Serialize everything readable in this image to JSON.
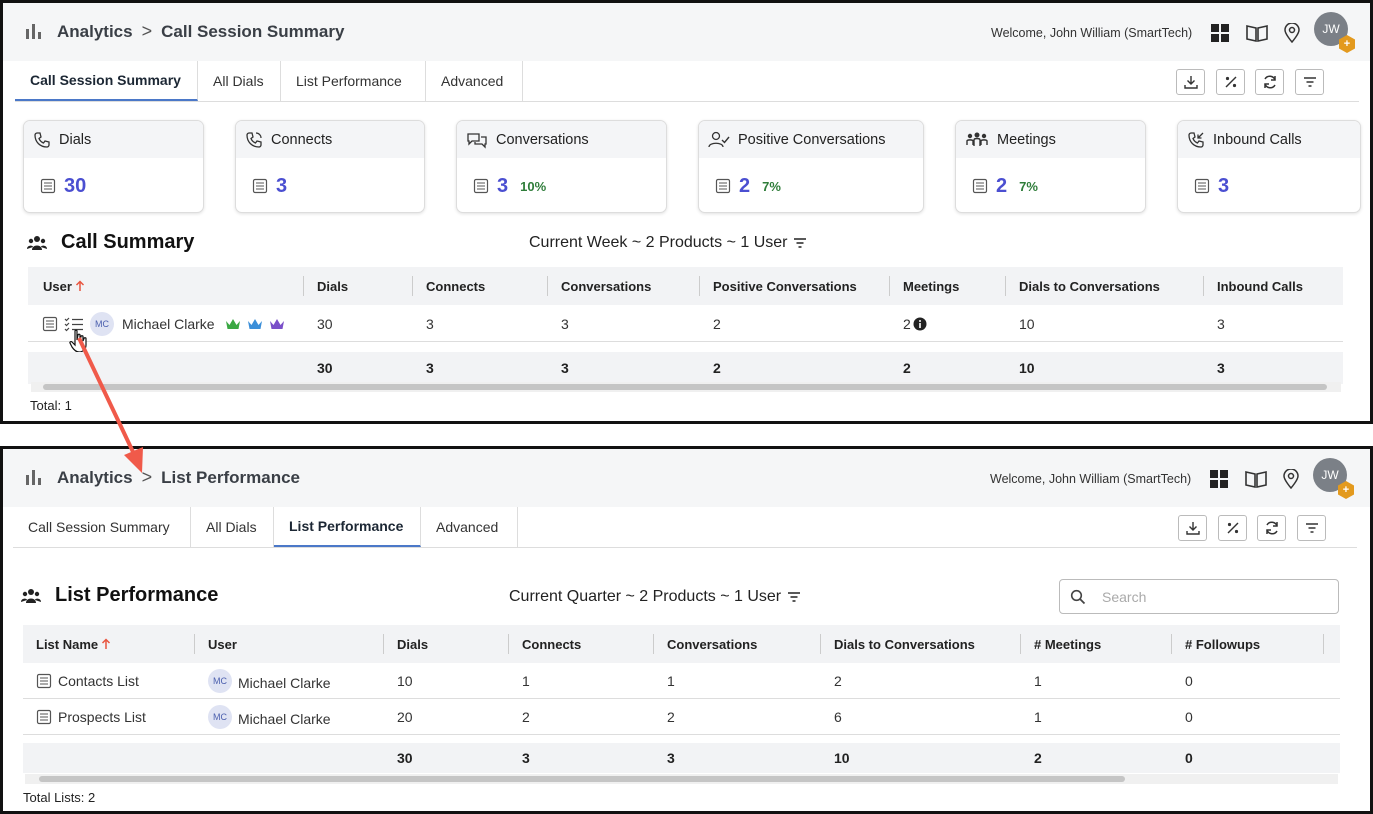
{
  "top": {
    "breadcrumb_root": "Analytics",
    "breadcrumb_sep": ">",
    "breadcrumb_current": "Call Session Summary",
    "welcome": "Welcome, John William (SmartTech)",
    "avatar_initials": "JW",
    "tabs": [
      "Call Session Summary",
      "All Dials",
      "List Performance",
      "Advanced"
    ],
    "active_tab": "Call Session Summary",
    "cards": [
      {
        "label": "Dials",
        "value": "30",
        "pct": ""
      },
      {
        "label": "Connects",
        "value": "3",
        "pct": ""
      },
      {
        "label": "Conversations",
        "value": "3",
        "pct": "10%"
      },
      {
        "label": "Positive Conversations",
        "value": "2",
        "pct": "7%"
      },
      {
        "label": "Meetings",
        "value": "2",
        "pct": "7%"
      },
      {
        "label": "Inbound Calls",
        "value": "3",
        "pct": ""
      }
    ],
    "section_title": "Call Summary",
    "filter": "Current Week ~ 2 Products ~ 1 User",
    "columns": [
      "User",
      "Dials",
      "Connects",
      "Conversations",
      "Positive Conversations",
      "Meetings",
      "Dials to Conversations",
      "Inbound Calls"
    ],
    "row": {
      "initials": "MC",
      "user": "Michael Clarke",
      "dials": "30",
      "connects": "3",
      "conversations": "3",
      "positive": "2",
      "meetings": "2",
      "dials_to_conv": "10",
      "inbound": "3"
    },
    "totals": {
      "dials": "30",
      "connects": "3",
      "conversations": "3",
      "positive": "2",
      "meetings": "2",
      "dials_to_conv": "10",
      "inbound": "3"
    },
    "total_label": "Total: 1",
    "crown_colors": [
      "#3aa843",
      "#3b8fd9",
      "#7a4fc9"
    ]
  },
  "bottom": {
    "breadcrumb_root": "Analytics",
    "breadcrumb_sep": ">",
    "breadcrumb_current": "List Performance",
    "welcome": "Welcome, John William (SmartTech)",
    "avatar_initials": "JW",
    "tabs": [
      "Call Session Summary",
      "All Dials",
      "List Performance",
      "Advanced"
    ],
    "active_tab": "List Performance",
    "section_title": "List Performance",
    "filter": "Current Quarter ~ 2 Products ~ 1 User",
    "search_placeholder": "Search",
    "columns": [
      "List Name",
      "User",
      "Dials",
      "Connects",
      "Conversations",
      "Dials to Conversations",
      "# Meetings",
      "# Followups"
    ],
    "rows": [
      {
        "list": "Contacts List",
        "initials": "MC",
        "user": "Michael Clarke",
        "dials": "10",
        "connects": "1",
        "conversations": "1",
        "dials_to_conv": "2",
        "meetings": "1",
        "followups": "0"
      },
      {
        "list": "Prospects List",
        "initials": "MC",
        "user": "Michael Clarke",
        "dials": "20",
        "connects": "2",
        "conversations": "2",
        "dials_to_conv": "6",
        "meetings": "1",
        "followups": "0"
      }
    ],
    "totals": {
      "dials": "30",
      "connects": "3",
      "conversations": "3",
      "dials_to_conv": "10",
      "meetings": "2",
      "followups": "0"
    },
    "total_label": "Total Lists: 2"
  },
  "colors": {
    "accent": "#4b4fd1",
    "pct_green": "#2f7d3a",
    "arrow": "#f05a4a",
    "sort_arrow": "#e8553f",
    "tab_underline": "#4b78c8",
    "badge": "#e39a1e"
  }
}
